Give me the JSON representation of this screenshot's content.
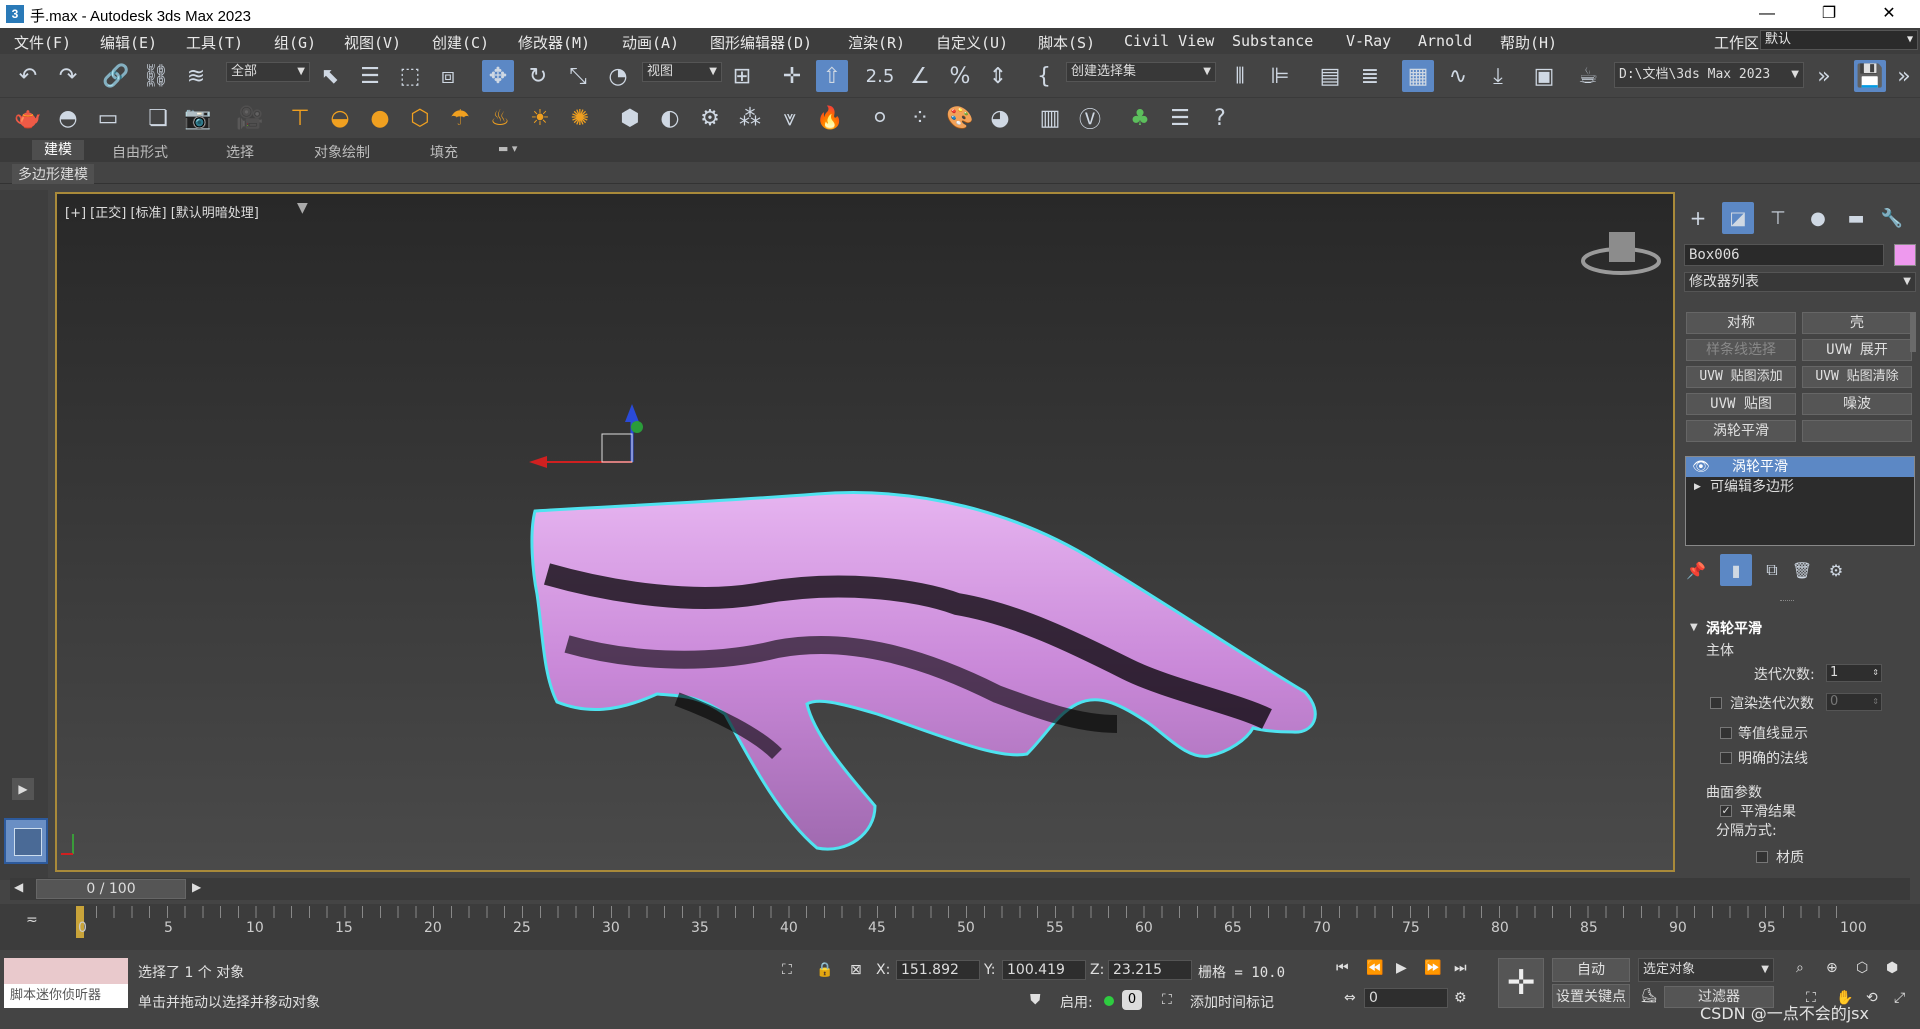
{
  "window": {
    "title": "手.max - Autodesk 3ds Max 2023",
    "app_icon": "3"
  },
  "menu": {
    "items": [
      "文件(F)",
      "编辑(E)",
      "工具(T)",
      "组(G)",
      "视图(V)",
      "创建(C)",
      "修改器(M)",
      "动画(A)",
      "图形编辑器(D)",
      "渲染(R)",
      "自定义(U)",
      "脚本(S)",
      "Civil View",
      "Substance",
      "V-Ray",
      "Arnold",
      "帮助(H)"
    ],
    "workspace_label": "工作区:",
    "workspace_value": "默认"
  },
  "toolbar": {
    "selection_filter": "全部",
    "ref_coord": "视图",
    "named_selection": "创建选择集",
    "project_path": "D:\\文档\\3ds Max 2023",
    "snap_label": "2.5"
  },
  "ribbon": {
    "tabs": [
      "建模",
      "自由形式",
      "选择",
      "对象绘制",
      "填充"
    ],
    "sub_label": "多边形建模"
  },
  "viewport": {
    "label": "[+] [正交] [标准] [默认明暗处理]",
    "object_color": "#d9a0e6",
    "selection_outline": "#4fe3f0"
  },
  "command_panel": {
    "object_name": "Box006",
    "object_swatch": "#ee99ee",
    "modifier_list": "修改器列表",
    "buttons": [
      "对称",
      "壳",
      "样条线选择",
      "UVW 展开",
      "UVW 贴图添加",
      "UVW 贴图清除",
      "UVW 贴图",
      "噪波",
      "涡轮平滑",
      ""
    ],
    "stack": [
      "涡轮平滑",
      "可编辑多边形"
    ],
    "rollout_title": "涡轮平滑",
    "main_group": "主体",
    "iterations_label": "迭代次数:",
    "iterations_value": "1",
    "render_iters_label": "渲染迭代次数",
    "render_iters_value": "0",
    "isoline_label": "等值线显示",
    "explicit_normals_label": "明确的法线",
    "surface_group": "曲面参数",
    "smooth_result_label": "平滑结果",
    "separate_by_label": "分隔方式:",
    "material_label": "材质"
  },
  "timeline": {
    "frame_display": "0 / 100",
    "ticks": [
      "0",
      "5",
      "10",
      "15",
      "20",
      "25",
      "30",
      "35",
      "40",
      "45",
      "50",
      "55",
      "60",
      "65",
      "70",
      "75",
      "80",
      "85",
      "90",
      "95",
      "100"
    ]
  },
  "status": {
    "maxscript_label": "脚本迷你侦听器",
    "selection_text": "选择了 1 个 对象",
    "prompt_text": "单击并拖动以选择并移动对象",
    "x_label": "X:",
    "x_value": "151.892",
    "y_label": "Y:",
    "y_value": "100.419",
    "z_label": "Z:",
    "z_value": "23.215",
    "grid_text": "栅格 = 10.0",
    "enable_label": "启用:",
    "enable_value": "0",
    "add_time_tag": "添加时间标记",
    "auto_key": "自动",
    "set_key": "设置关键点",
    "selected_object": "选定对象",
    "filters": "过滤器",
    "frame_value": "0",
    "watermark": "CSDN @一点不会的jsx"
  }
}
